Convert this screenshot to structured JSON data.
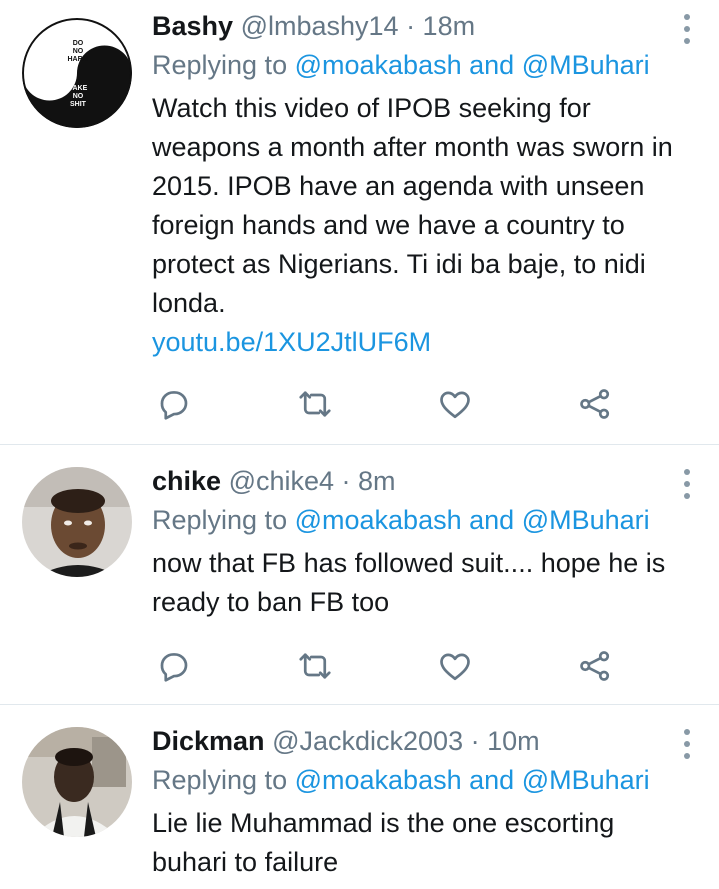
{
  "tweets": [
    {
      "name": "Bashy",
      "handle": "@lmbashy14",
      "time": "· 18m",
      "replying_to": "Replying to",
      "mention_1": "@moakabash",
      "joiner": "and",
      "mention_2": "@MBuhari",
      "text": "Watch this video of IPOB seeking for weapons a month after month was sworn in 2015. IPOB have an agenda with unseen foreign hands and we have a country to protect as Nigerians. Ti idi ba baje, to nidi londa.",
      "link": "youtu.be/1XU2JtlUF6M",
      "avatar_text": {
        "top": [
          "DO",
          "NO",
          "HARM"
        ],
        "bottom": [
          "TAKE",
          "NO",
          "SHIT"
        ]
      }
    },
    {
      "name": "chike",
      "handle": "@chike4",
      "time": "· 8m",
      "replying_to": "Replying to",
      "mention_1": "@moakabash",
      "joiner": "and",
      "mention_2": "@MBuhari",
      "text": "now that FB has followed suit.... hope he is ready to ban FB too"
    },
    {
      "name": "Dickman",
      "handle": "@Jackdick2003",
      "time": "· 10m",
      "replying_to": "Replying to",
      "mention_1": "@moakabash",
      "joiner": "and",
      "mention_2": "@MBuhari",
      "text": "Lie lie Muhammad is the one escorting buhari to failure"
    }
  ],
  "icons": [
    "reply-icon",
    "retweet-icon",
    "like-icon",
    "share-icon",
    "more-options-icon"
  ],
  "colors": {
    "link": "#1b95e0",
    "secondary_text": "#657786",
    "primary_text": "#14171a",
    "divider": "#e1e8ed",
    "icon": "#657786"
  }
}
